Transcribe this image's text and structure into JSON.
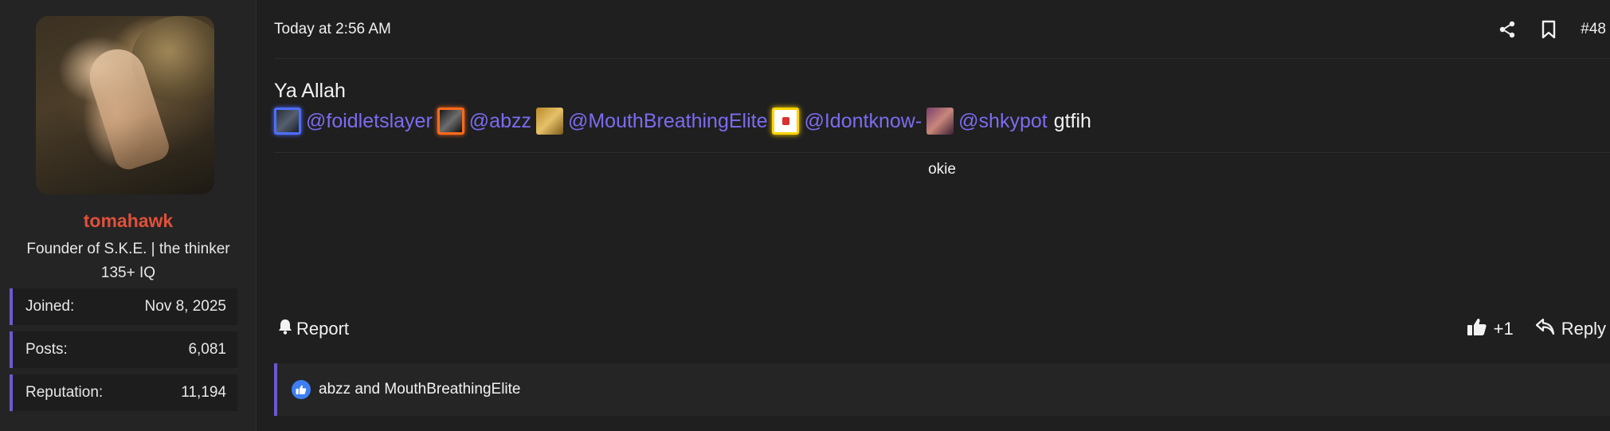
{
  "user": {
    "username": "tomahawk",
    "title_line1": "Founder of S.K.E. | the thinker",
    "title_line2": "135+ IQ",
    "stats": [
      {
        "label": "Joined:",
        "value": "Nov 8, 2025"
      },
      {
        "label": "Posts:",
        "value": "6,081"
      },
      {
        "label": "Reputation:",
        "value": "11,194"
      }
    ],
    "username_color": "#e0503a"
  },
  "post": {
    "timestamp": "Today at 2:56 AM",
    "number": "#48",
    "header_icons": [
      "share-icon",
      "bookmark-icon"
    ],
    "line1": "Ya Allah",
    "mentions": [
      {
        "handle": "@foidletslayer",
        "border_color": "#4e6dff"
      },
      {
        "handle": "@abzz",
        "border_color": "#ff6a1a"
      },
      {
        "handle": "@MouthBreathingElite",
        "border_color": ""
      },
      {
        "handle": "@Idontknow-",
        "border_color": "#ffd400"
      },
      {
        "handle": "@shkypot",
        "border_color": ""
      }
    ],
    "trailing_text": "gtfih",
    "quote_text": "okie",
    "mention_color": "#7b6cf0"
  },
  "actions": {
    "report_label": "Report",
    "like_label": "+1",
    "reply_label": "Reply",
    "icons": [
      "bell-icon",
      "thumbs-up-icon",
      "reply-icon"
    ]
  },
  "reactions": {
    "text": "abzz and MouthBreathingElite",
    "icon": "like-badge-icon",
    "accent": "#6a5acd"
  }
}
